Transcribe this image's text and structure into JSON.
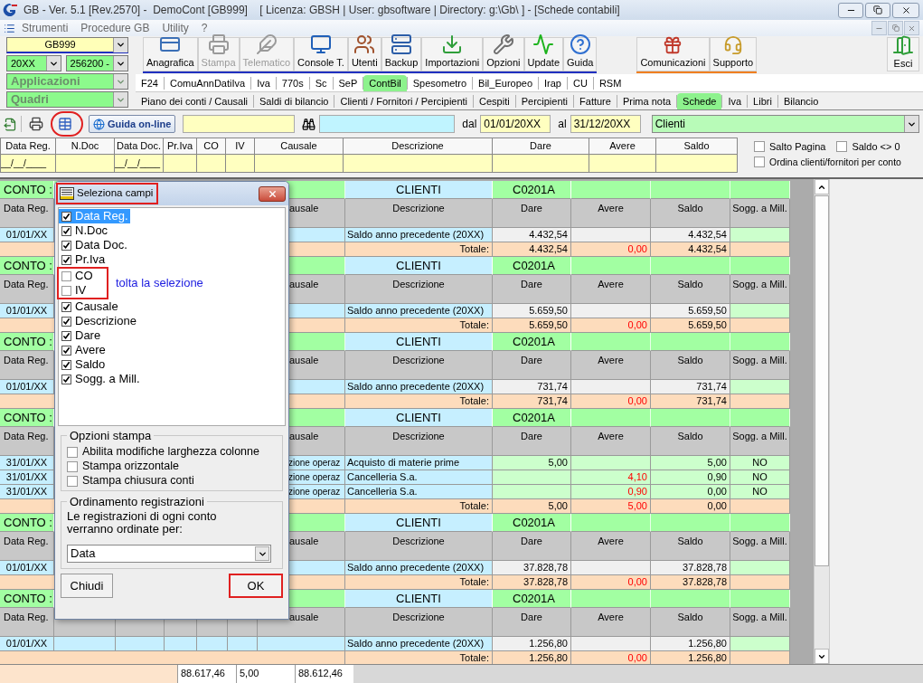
{
  "window": {
    "title": "GB - Ver. 5.1 [Rev.2570] -  DemoCont [GB999]    [ Licenza: GBSH | User: gbsoftware | Directory: g:\\Gb\\ ] - [Schede contabili]"
  },
  "menu": [
    "Strumenti",
    "Procedure GB",
    "Utility",
    "?"
  ],
  "selectors": {
    "company": "GB999",
    "year": "20XX",
    "account": "256200 -",
    "applications": "Applicazioni",
    "sections": "Quadri"
  },
  "toolbar": {
    "main": [
      {
        "label": "Anagrafica",
        "disabled": false
      },
      {
        "label": "Stampa",
        "disabled": true
      },
      {
        "label": "Telematico",
        "disabled": true
      },
      {
        "label": "Console T.",
        "disabled": false
      },
      {
        "label": "Utenti",
        "disabled": false
      },
      {
        "label": "Backup",
        "disabled": false
      },
      {
        "label": "Importazioni",
        "disabled": false
      },
      {
        "label": "Opzioni",
        "disabled": false
      },
      {
        "label": "Update",
        "disabled": false
      },
      {
        "label": "Guida",
        "disabled": false
      }
    ],
    "support": [
      {
        "label": "Comunicazioni",
        "disabled": false
      },
      {
        "label": "Supporto",
        "disabled": false
      }
    ],
    "exit": "Esci"
  },
  "modules": [
    {
      "label": "F24",
      "selected": false
    },
    {
      "label": "ComuAnnDatiIva",
      "selected": false
    },
    {
      "label": "Iva",
      "selected": false
    },
    {
      "label": "770s",
      "selected": false
    },
    {
      "label": "Sc",
      "selected": false
    },
    {
      "label": "SeP",
      "selected": false
    },
    {
      "label": "ContBil",
      "selected": true
    },
    {
      "label": "Spesometro",
      "selected": false
    },
    {
      "label": "Bil_Europeo",
      "selected": false
    },
    {
      "label": "Irap",
      "selected": false
    },
    {
      "label": "CU",
      "selected": false
    },
    {
      "label": "RSM",
      "selected": false
    }
  ],
  "subtabs": [
    {
      "label": "Piano dei conti / Causali",
      "selected": false
    },
    {
      "label": "Saldi di bilancio",
      "selected": false
    },
    {
      "label": "Clienti / Fornitori / Percipienti",
      "selected": false
    },
    {
      "label": "Cespiti",
      "selected": false
    },
    {
      "label": "Percipienti",
      "selected": false
    },
    {
      "label": "Fatture",
      "selected": false
    },
    {
      "label": "Prima nota",
      "selected": false
    },
    {
      "label": "Schede",
      "selected": true
    },
    {
      "label": "Iva",
      "selected": false
    },
    {
      "label": "Libri",
      "selected": false
    },
    {
      "label": "Bilancio",
      "selected": false
    }
  ],
  "filter_bar": {
    "help_button": "Guida on-line",
    "from_label": "dal",
    "from": "01/01/20XX",
    "to_label": "al",
    "to": "31/12/20XX",
    "account_type": "Clienti"
  },
  "column_filters": [
    {
      "label": "Data Reg.",
      "value": "__/__/____"
    },
    {
      "label": "N.Doc"
    },
    {
      "label": "Data Doc.",
      "value": "__/__/____"
    },
    {
      "label": "Pr.Iva"
    },
    {
      "label": "CO"
    },
    {
      "label": "IV"
    },
    {
      "label": "Causale"
    },
    {
      "label": "Descrizione"
    },
    {
      "label": "Dare"
    },
    {
      "label": "Avere"
    },
    {
      "label": "Saldo"
    }
  ],
  "options": [
    {
      "label": "Salto Pagina",
      "checked": false
    },
    {
      "label": "Saldo <> 0",
      "checked": false
    },
    {
      "label": "Ordina clienti/fornitori per conto",
      "checked": false
    }
  ],
  "accounts": [
    {
      "conto": "CONTO :",
      "type": "CLIENTI",
      "code": "C0201A",
      "headers": [
        "Data Reg.",
        "ausale",
        "Descrizione",
        "Dare",
        "Avere",
        "Saldo",
        "Sogg. a Mill."
      ],
      "rows": [
        {
          "kind": "opening",
          "date": "01/01/XX",
          "descrizione": "Saldo anno precedente (20XX)",
          "dare": "4.432,54",
          "saldo": "4.432,54"
        }
      ],
      "total": {
        "label": "Totale:",
        "dare": "4.432,54",
        "avere": "0,00",
        "saldo": "4.432,54"
      }
    },
    {
      "conto": "CONTO :",
      "type": "CLIENTI",
      "code": "C0201A",
      "headers": [
        "Data Reg.",
        "ausale",
        "Descrizione",
        "Dare",
        "Avere",
        "Saldo",
        "Sogg. a Mill."
      ],
      "rows": [
        {
          "kind": "opening",
          "date": "01/01/XX",
          "descrizione": "Saldo anno precedente (20XX)",
          "dare": "5.659,50",
          "saldo": "5.659,50"
        }
      ],
      "total": {
        "label": "Totale:",
        "dare": "5.659,50",
        "avere": "0,00",
        "saldo": "5.659,50"
      }
    },
    {
      "conto": "CONTO :",
      "type": "CLIENTI",
      "code": "C0201A",
      "headers": [
        "Data Reg.",
        "ausale",
        "Descrizione",
        "Dare",
        "Avere",
        "Saldo",
        "Sogg. a Mill."
      ],
      "rows": [
        {
          "kind": "opening",
          "date": "01/01/XX",
          "descrizione": "Saldo anno precedente (20XX)",
          "dare": "731,74",
          "saldo": "731,74"
        }
      ],
      "total": {
        "label": "Totale:",
        "dare": "731,74",
        "avere": "0,00",
        "saldo": "731,74"
      }
    },
    {
      "conto": "CONTO :",
      "type": "CLIENTI",
      "code": "C0201A",
      "headers": [
        "Data Reg.",
        "ausale",
        "Descrizione",
        "Dare",
        "Avere",
        "Saldo",
        "Sogg. a Mill."
      ],
      "rows": [
        {
          "kind": "movement",
          "date": "31/01/XX",
          "causale": "zione operaz",
          "descrizione": "Acquisto di materie prime",
          "dare": "5,00",
          "saldo": "5,00",
          "sogg": "NO"
        },
        {
          "kind": "movement",
          "date": "31/01/XX",
          "causale": "zione operaz",
          "descrizione": "Cancelleria S.a.",
          "avere": "4,10",
          "saldo": "0,90",
          "sogg": "NO"
        },
        {
          "kind": "movement",
          "date": "31/01/XX",
          "causale": "zione operaz",
          "descrizione": "Cancelleria S.a.",
          "avere": "0,90",
          "saldo": "0,00",
          "sogg": "NO"
        }
      ],
      "total": {
        "label": "Totale:",
        "dare": "5,00",
        "avere": "5,00",
        "saldo": "0,00"
      }
    },
    {
      "conto": "CONTO :",
      "type": "CLIENTI",
      "code": "C0201A",
      "headers": [
        "Data Reg.",
        "ausale",
        "Descrizione",
        "Dare",
        "Avere",
        "Saldo",
        "Sogg. a Mill."
      ],
      "rows": [
        {
          "kind": "opening",
          "date": "01/01/XX",
          "descrizione": "Saldo anno precedente (20XX)",
          "dare": "37.828,78",
          "saldo": "37.828,78"
        }
      ],
      "total": {
        "label": "Totale:",
        "dare": "37.828,78",
        "avere": "0,00",
        "saldo": "37.828,78"
      }
    },
    {
      "conto": "CONTO :",
      "type": "CLIENTI",
      "code": "C0201A",
      "headers": [
        "Data Reg.",
        "ausale",
        "Descrizione",
        "Dare",
        "Avere",
        "Saldo",
        "Sogg. a Mill."
      ],
      "rows": [
        {
          "kind": "opening",
          "date": "01/01/XX",
          "descrizione": "Saldo anno precedente (20XX)",
          "dare": "1.256,80",
          "saldo": "1.256,80"
        }
      ],
      "total": {
        "label": "Totale:",
        "dare": "1.256,80",
        "avere": "0,00",
        "saldo": "1.256,80"
      }
    }
  ],
  "footer_totals": [
    "88.617,46",
    "5,00",
    "88.612,46"
  ],
  "dialog": {
    "title": "Seleziona campi",
    "fields": [
      {
        "label": "Data Reg.",
        "checked": true,
        "selected": true
      },
      {
        "label": "N.Doc",
        "checked": true,
        "selected": false
      },
      {
        "label": "Data Doc.",
        "checked": true,
        "selected": false
      },
      {
        "label": "Pr.Iva",
        "checked": true,
        "selected": false
      },
      {
        "label": "CO",
        "checked": false,
        "selected": false
      },
      {
        "label": "IV",
        "checked": false,
        "selected": false
      },
      {
        "label": "Causale",
        "checked": true,
        "selected": false
      },
      {
        "label": "Descrizione",
        "checked": true,
        "selected": false
      },
      {
        "label": "Dare",
        "checked": true,
        "selected": false
      },
      {
        "label": "Avere",
        "checked": true,
        "selected": false
      },
      {
        "label": "Saldo",
        "checked": true,
        "selected": false
      },
      {
        "label": "Sogg. a Mill.",
        "checked": true,
        "selected": false
      }
    ],
    "annotation": "tolta la selezione",
    "print_options": {
      "title": "Opzioni stampa",
      "items": [
        {
          "label": "Abilita modifiche larghezza colonne",
          "checked": false
        },
        {
          "label": "Stampa orizzontale",
          "checked": false
        },
        {
          "label": "Stampa chiusura conti",
          "checked": false
        }
      ]
    },
    "ordering": {
      "title": "Ordinamento registrazioni",
      "text": "Le registrazioni di ogni conto verranno ordinate per:",
      "value": "Data"
    },
    "close_button": "Chiudi",
    "ok_button": "OK"
  }
}
